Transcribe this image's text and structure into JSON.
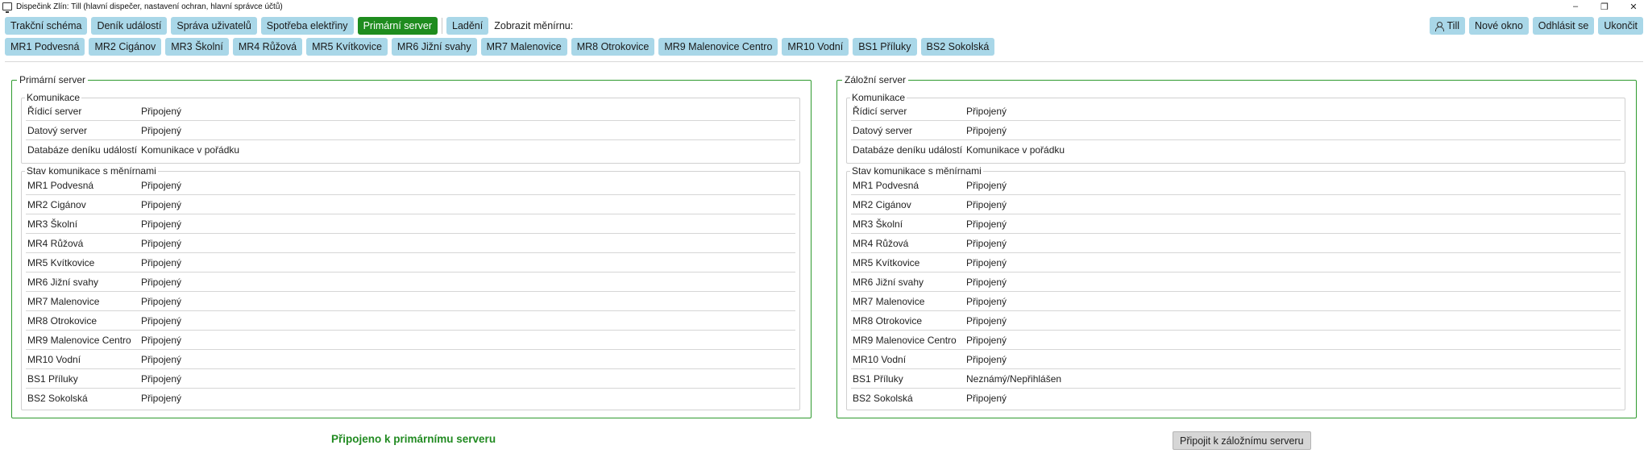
{
  "window": {
    "title": "Dispečink Zlín: Till (hlavní dispečer, nastavení ochran, hlavní správce účtů)",
    "controls": {
      "minimize": "–",
      "restore": "❐",
      "close": "✕"
    }
  },
  "toolbar": {
    "tabs": [
      {
        "label": "Trakční schéma"
      },
      {
        "label": "Deník událostí"
      },
      {
        "label": "Správa uživatelů"
      },
      {
        "label": "Spotřeba elektřiny"
      },
      {
        "label": "Primární server"
      }
    ],
    "debug_label": "Ladění",
    "show_label": "Zobrazit měnírnu:",
    "user_label": "Till",
    "new_window_label": "Nové okno",
    "logout_label": "Odhlásit se",
    "quit_label": "Ukončit"
  },
  "substations": [
    "MR1 Podvesná",
    "MR2 Cigánov",
    "MR3 Školní",
    "MR4 Růžová",
    "MR5 Kvítkovice",
    "MR6 Jižní svahy",
    "MR7 Malenovice",
    "MR8 Otrokovice",
    "MR9 Malenovice Centro",
    "MR10 Vodní",
    "BS1 Příluky",
    "BS2 Sokolská"
  ],
  "primary": {
    "title": "Primární server",
    "comm_title": "Komunikace",
    "comm": [
      {
        "k": "Řídicí server",
        "v": "Připojený"
      },
      {
        "k": "Datový server",
        "v": "Připojený"
      },
      {
        "k": "Databáze deníku událostí",
        "v": "Komunikace v pořádku"
      }
    ],
    "status_title": "Stav komunikace s měnírnami",
    "status": [
      {
        "k": "MR1 Podvesná",
        "v": "Připojený"
      },
      {
        "k": "MR2 Cigánov",
        "v": "Připojený"
      },
      {
        "k": "MR3 Školní",
        "v": "Připojený"
      },
      {
        "k": "MR4 Růžová",
        "v": "Připojený"
      },
      {
        "k": "MR5 Kvítkovice",
        "v": "Připojený"
      },
      {
        "k": "MR6 Jižní svahy",
        "v": "Připojený"
      },
      {
        "k": "MR7 Malenovice",
        "v": "Připojený"
      },
      {
        "k": "MR8 Otrokovice",
        "v": "Připojený"
      },
      {
        "k": "MR9 Malenovice Centro",
        "v": "Připojený"
      },
      {
        "k": "MR10 Vodní",
        "v": "Připojený"
      },
      {
        "k": "BS1 Příluky",
        "v": "Připojený"
      },
      {
        "k": "BS2 Sokolská",
        "v": "Připojený"
      }
    ]
  },
  "backup": {
    "title": "Záložní server",
    "comm_title": "Komunikace",
    "comm": [
      {
        "k": "Řídicí server",
        "v": "Připojený"
      },
      {
        "k": "Datový server",
        "v": "Připojený"
      },
      {
        "k": "Databáze deníku událostí",
        "v": "Komunikace v pořádku"
      }
    ],
    "status_title": "Stav komunikace s měnírnami",
    "status": [
      {
        "k": "MR1 Podvesná",
        "v": "Připojený"
      },
      {
        "k": "MR2 Cigánov",
        "v": "Připojený"
      },
      {
        "k": "MR3 Školní",
        "v": "Připojený"
      },
      {
        "k": "MR4 Růžová",
        "v": "Připojený"
      },
      {
        "k": "MR5 Kvítkovice",
        "v": "Připojený"
      },
      {
        "k": "MR6 Jižní svahy",
        "v": "Připojený"
      },
      {
        "k": "MR7 Malenovice",
        "v": "Připojený"
      },
      {
        "k": "MR8 Otrokovice",
        "v": "Připojený"
      },
      {
        "k": "MR9 Malenovice Centro",
        "v": "Připojený"
      },
      {
        "k": "MR10 Vodní",
        "v": "Připojený"
      },
      {
        "k": "BS1 Příluky",
        "v": "Neznámý/Nepřihlášen"
      },
      {
        "k": "BS2 Sokolská",
        "v": "Připojený"
      }
    ]
  },
  "footer": {
    "connected_text": "Připojeno k primárnímu serveru",
    "connect_backup_label": "Připojit k záložnímu serveru"
  },
  "colors": {
    "tab_bg": "#a9d7e8",
    "active_tab_bg": "#1e8c1e",
    "panel_border": "#2e9a2e",
    "status_text": "#228b22"
  }
}
